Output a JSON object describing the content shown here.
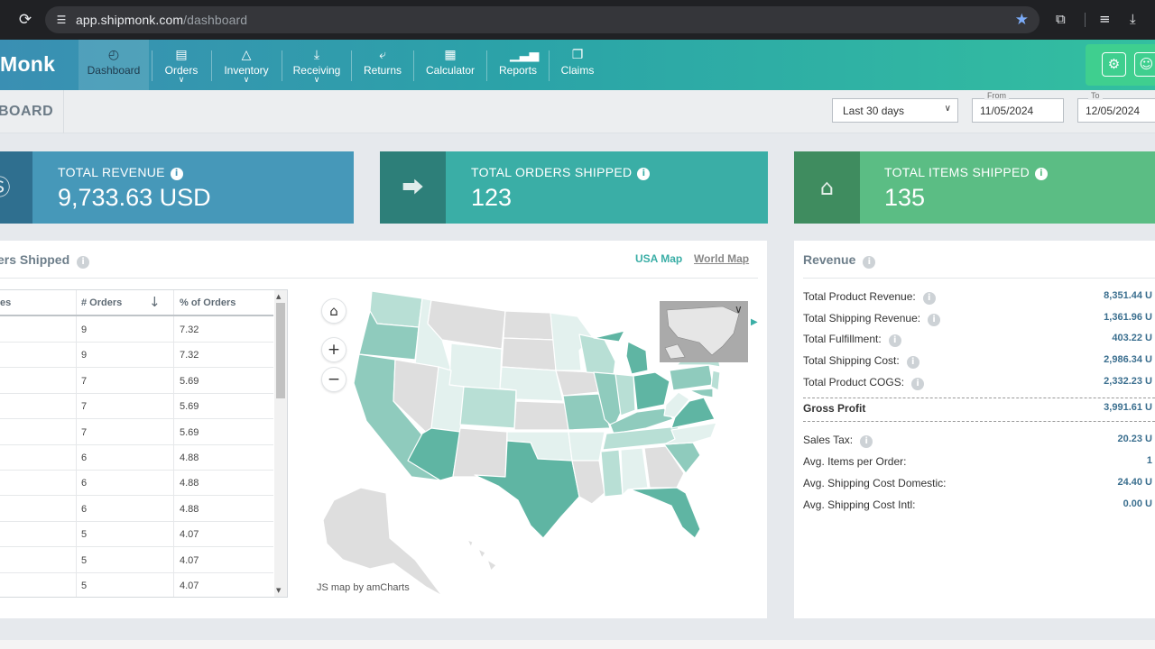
{
  "browser": {
    "url_host": "app.shipmonk.com",
    "url_path": "/dashboard",
    "icons": [
      "reload-icon",
      "site-settings-icon",
      "bookmark-star-icon",
      "extensions-icon",
      "media-icon",
      "download-icon"
    ]
  },
  "nav": {
    "logo": "Monk",
    "items": [
      {
        "label": "Dashboard",
        "icon": "dashboard-icon"
      },
      {
        "label": "Orders",
        "icon": "orders-icon"
      },
      {
        "label": "Inventory",
        "icon": "inventory-icon"
      },
      {
        "label": "Receiving",
        "icon": "receiving-icon"
      },
      {
        "label": "Returns",
        "icon": "returns-icon"
      },
      {
        "label": "Calculator",
        "icon": "calculator-icon"
      },
      {
        "label": "Reports",
        "icon": "reports-icon"
      },
      {
        "label": "Claims",
        "icon": "claims-icon"
      }
    ],
    "right_icons": [
      "settings-icon",
      "user-icon"
    ]
  },
  "header": {
    "title": "BOARD",
    "range": "Last 30 days",
    "from_label": "From",
    "from_value": "11/05/2024",
    "to_label": "To",
    "to_value": "12/05/2024"
  },
  "kpis": [
    {
      "label": "TOTAL REVENUE",
      "value": "9,733.63 USD",
      "color": "#4698b9",
      "icon_color": "#2f6f8f"
    },
    {
      "label": "TOTAL ORDERS SHIPPED",
      "value": "123",
      "color": "#3aaea6",
      "icon_color": "#2d7f79"
    },
    {
      "label": "TOTAL ITEMS SHIPPED",
      "value": "135",
      "color": "#5bbd84",
      "icon_color": "#3f8c5f"
    }
  ],
  "orders_panel": {
    "title": "ers Shipped",
    "tab_usa": "USA Map",
    "tab_world": "World Map",
    "columns": [
      "es",
      "# Orders",
      "% of Orders"
    ],
    "rows": [
      {
        "orders": "9",
        "pct": "7.32"
      },
      {
        "orders": "9",
        "pct": "7.32"
      },
      {
        "orders": "7",
        "pct": "5.69"
      },
      {
        "orders": "7",
        "pct": "5.69"
      },
      {
        "orders": "7",
        "pct": "5.69"
      },
      {
        "orders": "6",
        "pct": "4.88"
      },
      {
        "orders": "6",
        "pct": "4.88"
      },
      {
        "orders": "6",
        "pct": "4.88"
      },
      {
        "orders": "5",
        "pct": "4.07"
      },
      {
        "orders": "5",
        "pct": "4.07"
      },
      {
        "orders": "5",
        "pct": "4.07"
      }
    ],
    "map_credit": "JS map by amCharts",
    "map_colors": {
      "high": "#5fb5a3",
      "mid": "#8fcbbd",
      "low": "#b8dfd5",
      "lowest": "#e3f1ee",
      "none": "#dedede"
    }
  },
  "revenue": {
    "title": "Revenue",
    "rows": [
      {
        "label": "Total Product Revenue:",
        "value": "8,351.44 U",
        "info": true
      },
      {
        "label": "Total Shipping Revenue:",
        "value": "1,361.96 U",
        "info": true
      },
      {
        "label": "Total Fulfillment:",
        "value": "403.22 U",
        "info": true
      },
      {
        "label": "Total Shipping Cost:",
        "value": "2,986.34 U",
        "info": true
      },
      {
        "label": "Total Product COGS:",
        "value": "2,332.23 U",
        "info": true
      }
    ],
    "gross_label": "Gross Profit",
    "gross_value": "3,991.61 U",
    "rows2": [
      {
        "label": "Sales Tax:",
        "value": "20.23 U",
        "info": true
      },
      {
        "label": "Avg. Items per Order:",
        "value": "1",
        "info": false
      },
      {
        "label": "Avg. Shipping Cost Domestic:",
        "value": "24.40 U",
        "info": false
      },
      {
        "label": "Avg. Shipping Cost Intl:",
        "value": "0.00 U",
        "info": false
      }
    ]
  }
}
